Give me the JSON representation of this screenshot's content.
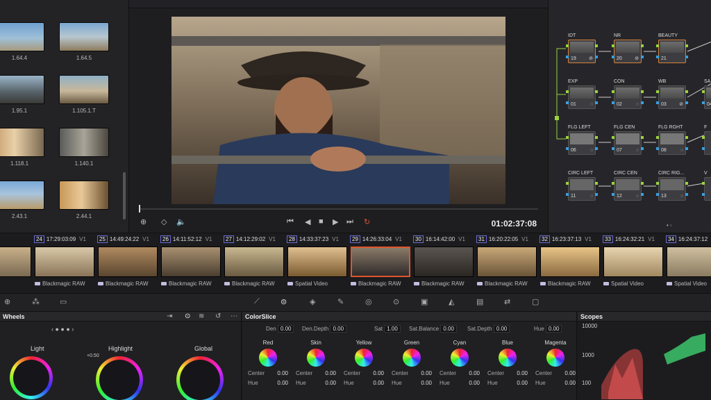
{
  "media_pool": {
    "clips": [
      {
        "label": "1.64.4"
      },
      {
        "label": "1.64.5"
      },
      {
        "label": "1.95.1"
      },
      {
        "label": "1.105.1.T"
      },
      {
        "label": "1.118.1"
      },
      {
        "label": "1.140.1"
      },
      {
        "label": "2.43.1"
      },
      {
        "label": "2.44.1"
      }
    ]
  },
  "viewer": {
    "timecode": "01:02:37:08",
    "transport": [
      "⏮",
      "◀",
      "■",
      "▶",
      "⏭",
      "↻"
    ]
  },
  "node_graph": {
    "nodes": [
      {
        "title": "IDT",
        "num": "19",
        "flag": "⊘"
      },
      {
        "title": "NR",
        "num": "20",
        "flag": "⊘"
      },
      {
        "title": "BEAUTY",
        "num": "21",
        "flag": ""
      },
      {
        "title": "EXP",
        "num": "01",
        "flag": "◌"
      },
      {
        "title": "CON",
        "num": "02",
        "flag": "◌"
      },
      {
        "title": "WB",
        "num": "03",
        "flag": "⊘"
      },
      {
        "title": "SA",
        "num": "04",
        "flag": ""
      },
      {
        "title": "FLG LEFT",
        "num": "06",
        "flag": "◌"
      },
      {
        "title": "FLG CEN",
        "num": "07",
        "flag": "◌"
      },
      {
        "title": "FLG RGHT",
        "num": "08",
        "flag": "◌"
      },
      {
        "title": "F",
        "num": "",
        "flag": ""
      },
      {
        "title": "CIRC LEFT",
        "num": "11",
        "flag": "◌"
      },
      {
        "title": "CIRC CEN",
        "num": "12",
        "flag": "◌"
      },
      {
        "title": "CIRC RIG...",
        "num": "13",
        "flag": "◌"
      },
      {
        "title": "V",
        "num": "",
        "flag": ""
      }
    ],
    "pager": "• ◦"
  },
  "timeline": {
    "clips": [
      {
        "num": "",
        "tc": "42:06",
        "track": "",
        "codec": "RAW",
        "selected": false
      },
      {
        "num": "24",
        "tc": "17:29:03:09",
        "track": "V1",
        "codec": "Blackmagic RAW",
        "selected": false
      },
      {
        "num": "25",
        "tc": "14:49:24:22",
        "track": "V1",
        "codec": "Blackmagic RAW",
        "selected": false
      },
      {
        "num": "26",
        "tc": "14:11:52:12",
        "track": "V1",
        "codec": "Blackmagic RAW",
        "selected": false
      },
      {
        "num": "27",
        "tc": "14:12:29:02",
        "track": "V1",
        "codec": "Blackmagic RAW",
        "selected": false
      },
      {
        "num": "28",
        "tc": "14:33:37:23",
        "track": "V1",
        "codec": "Spatial Video",
        "selected": false
      },
      {
        "num": "29",
        "tc": "14:26:33:04",
        "track": "V1",
        "codec": "Blackmagic RAW",
        "selected": true
      },
      {
        "num": "30",
        "tc": "16:14:42:00",
        "track": "V1",
        "codec": "Blackmagic RAW",
        "selected": false
      },
      {
        "num": "31",
        "tc": "16:20:22:05",
        "track": "V1",
        "codec": "Blackmagic RAW",
        "selected": false
      },
      {
        "num": "32",
        "tc": "16:23:37:13",
        "track": "V1",
        "codec": "Blackmagic RAW",
        "selected": false
      },
      {
        "num": "33",
        "tc": "16:24:32:21",
        "track": "V1",
        "codec": "Spatial Video",
        "selected": false
      },
      {
        "num": "34",
        "tc": "16:24:37:12",
        "track": "",
        "codec": "Spatial Video",
        "selected": false
      }
    ]
  },
  "wheels": {
    "title": "Wheels",
    "wheel_labels": [
      "Light",
      "Highlight",
      "Global"
    ],
    "highlight_value": "+0.50"
  },
  "colorslice": {
    "title": "ColorSlice",
    "params": [
      {
        "label": "Den",
        "value": "0.00"
      },
      {
        "label": "Den.Depth",
        "value": "0.00"
      },
      {
        "label": "Sat",
        "value": "1.00"
      },
      {
        "label": "Sat.Balance",
        "value": "0.00"
      },
      {
        "label": "Sat.Depth",
        "value": "0.00"
      },
      {
        "label": "Hue",
        "value": "0.00"
      }
    ],
    "columns": [
      {
        "name": "Red",
        "center": "0.00",
        "hue": "0.00"
      },
      {
        "name": "Skin",
        "center": "0.00",
        "hue": "0.00"
      },
      {
        "name": "Yellow",
        "center": "0.00",
        "hue": "0.00"
      },
      {
        "name": "Green",
        "center": "0.00",
        "hue": "0.00"
      },
      {
        "name": "Cyan",
        "center": "0.00",
        "hue": "0.00"
      },
      {
        "name": "Blue",
        "center": "0.00",
        "hue": "0.00"
      },
      {
        "name": "Magenta",
        "center": "0.00",
        "hue": "0.00"
      }
    ],
    "center_label": "Center",
    "hue_label": "Hue"
  },
  "scopes": {
    "title": "Scopes",
    "ticks": [
      "10000",
      "1000",
      "100"
    ]
  },
  "colors": {
    "accent_selected": "#e0552e",
    "node_green": "#9bd43a",
    "node_blue": "#3aa0e0"
  }
}
